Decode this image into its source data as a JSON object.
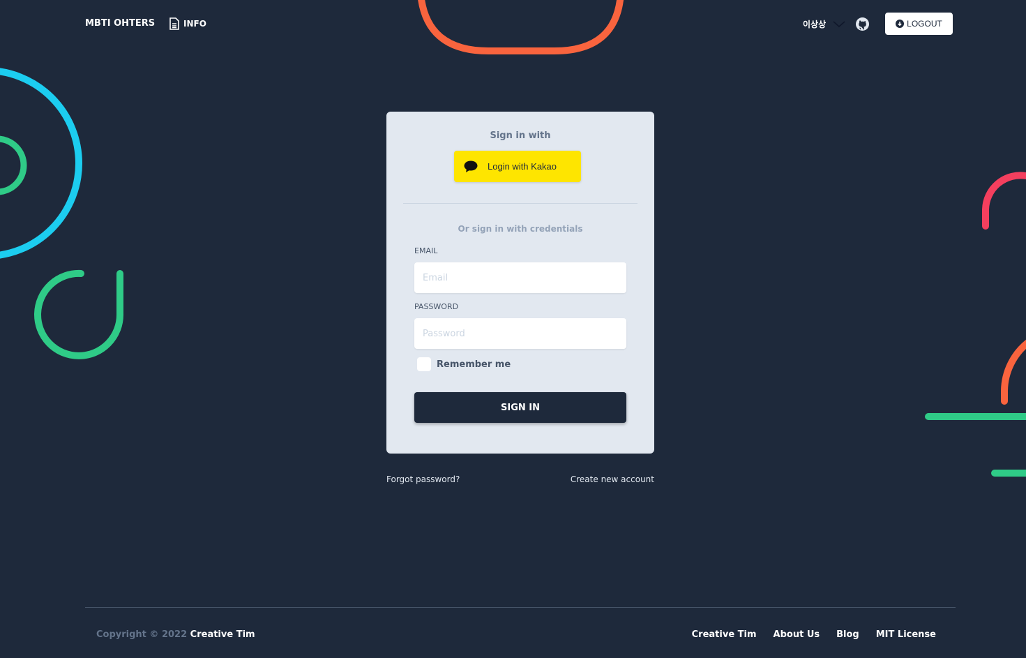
{
  "nav": {
    "brand": "MBTI OHTERS",
    "info": "INFO",
    "user": "이상상",
    "logout": "LOGOUT"
  },
  "card": {
    "sign_in_with": "Sign in with",
    "kakao": "Login with Kakao",
    "or_credentials": "Or sign in with credentials",
    "email_label": "EMAIL",
    "email_placeholder": "Email",
    "email_value": "",
    "password_label": "PASSWORD",
    "password_placeholder": "Password",
    "password_value": "",
    "remember": "Remember me",
    "remember_checked": false,
    "sign_in": "SIGN IN"
  },
  "links": {
    "forgot": "Forgot password?",
    "create": "Create new account"
  },
  "footer": {
    "copyright": "Copyright © 2022",
    "copyright_link": "Creative Tim",
    "links": [
      "Creative Tim",
      "About Us",
      "Blog",
      "MIT License"
    ]
  },
  "colors": {
    "background": "#1e293b",
    "card": "#e2e8f0",
    "kakao": "#fee500"
  }
}
